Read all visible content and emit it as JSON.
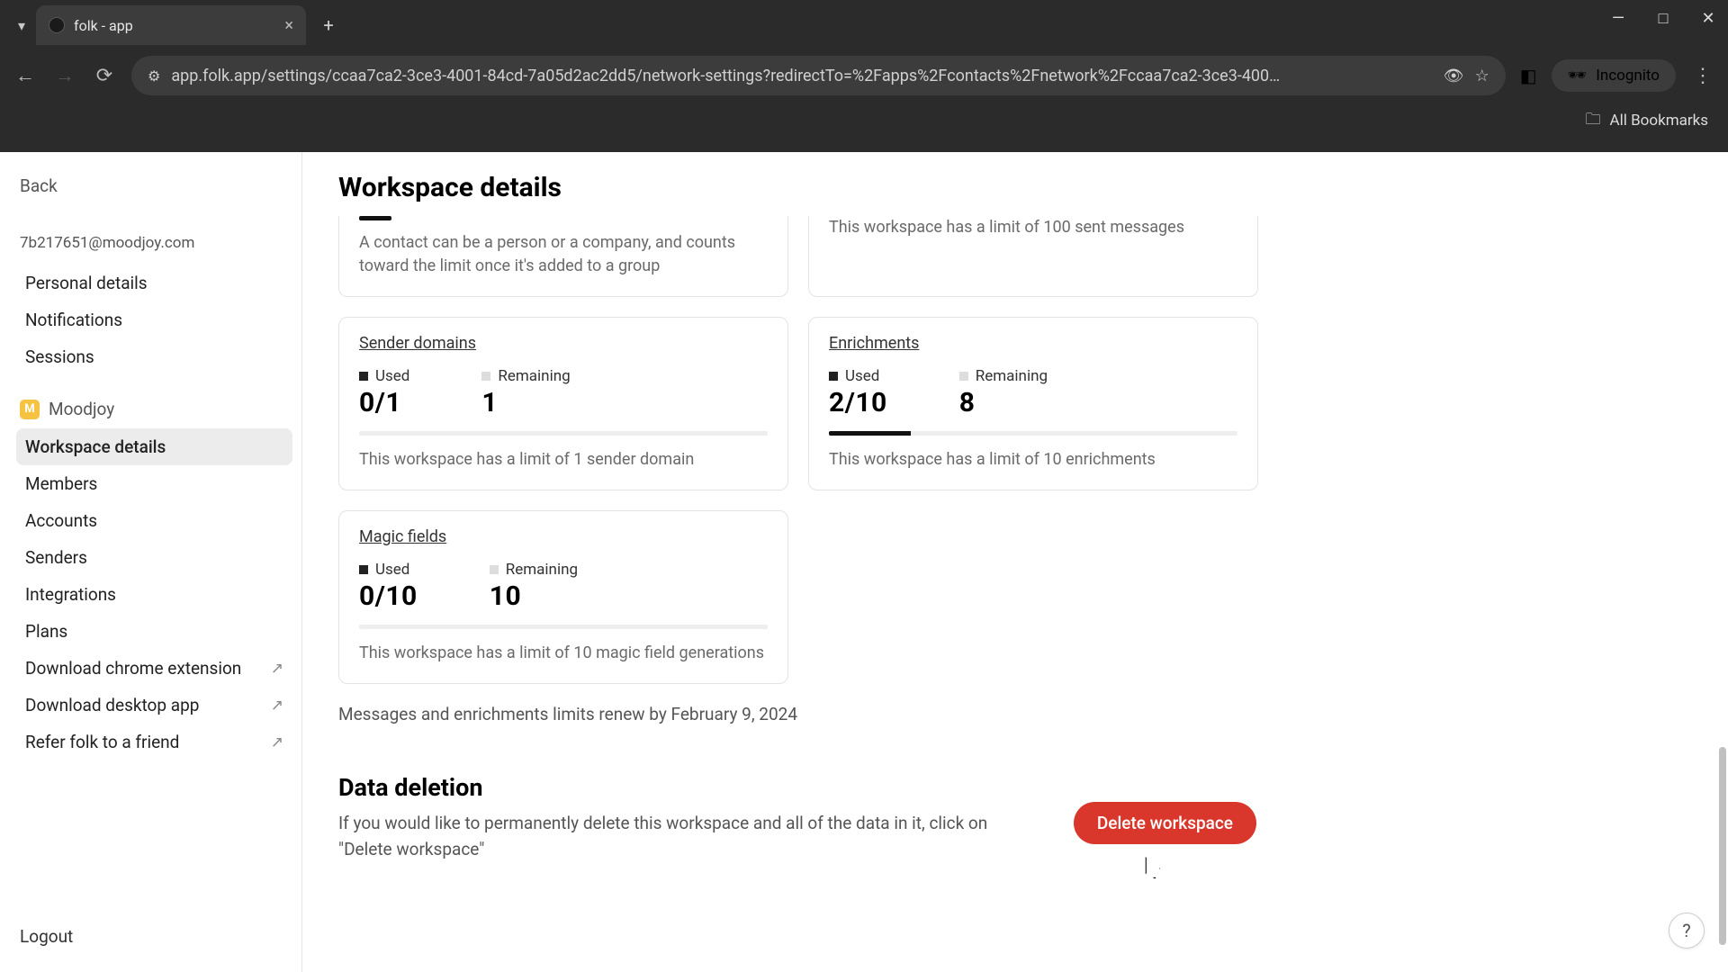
{
  "browser": {
    "tab_title": "folk - app",
    "url": "app.folk.app/settings/ccaa7ca2-3ce3-4001-84cd-7a05d2ac2dd5/network-settings?redirectTo=%2Fapps%2Fcontacts%2Fnetwork%2Fccaa7ca2-3ce3-400…",
    "incognito_label": "Incognito",
    "bookmarks_label": "All Bookmarks"
  },
  "sidebar": {
    "back": "Back",
    "email": "7b217651@moodjoy.com",
    "personal": [
      "Personal details",
      "Notifications",
      "Sessions"
    ],
    "workspace_name": "Moodjoy",
    "workspace_badge": "M",
    "workspace_items": [
      "Workspace details",
      "Members",
      "Accounts",
      "Senders",
      "Integrations",
      "Plans",
      "Download chrome extension",
      "Download desktop app",
      "Refer folk to a friend"
    ],
    "logout": "Logout"
  },
  "page": {
    "title": "Workspace details",
    "truncated_left_desc": "A contact can be a person or a company, and counts toward the limit once it's added to a group",
    "truncated_right_desc": "This workspace has a limit of 100 sent messages",
    "cards": [
      {
        "title": "Sender domains",
        "used_label": "Used",
        "used_value": "0/1",
        "remaining_label": "Remaining",
        "remaining_value": "1",
        "progress_pct": 0,
        "desc": "This workspace has a limit of 1 sender domain"
      },
      {
        "title": "Enrichments",
        "used_label": "Used",
        "used_value": "2/10",
        "remaining_label": "Remaining",
        "remaining_value": "8",
        "progress_pct": 20,
        "desc": "This workspace has a limit of 10 enrichments"
      },
      {
        "title": "Magic fields",
        "used_label": "Used",
        "used_value": "0/10",
        "remaining_label": "Remaining",
        "remaining_value": "10",
        "progress_pct": 0,
        "desc": "This workspace has a limit of 10 magic field generations"
      }
    ],
    "renew_note": "Messages and enrichments limits renew by February 9, 2024",
    "deletion": {
      "title": "Data deletion",
      "desc": "If you would like to permanently delete this workspace and all of the data in it, click on \"Delete workspace\"",
      "button": "Delete workspace"
    },
    "help": "?"
  }
}
